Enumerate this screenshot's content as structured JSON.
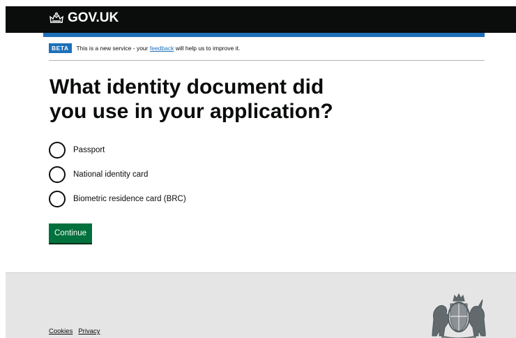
{
  "header": {
    "logo_text": "GOV.UK",
    "crown_icon": "crown-icon",
    "background": "#0b0c0c",
    "accent": "#1d70b8"
  },
  "phase_banner": {
    "tag": "BETA",
    "text_before": "This is a new service - your ",
    "link_text": "feedback",
    "text_after": " will help us to improve it."
  },
  "main": {
    "heading": "What identity document did you use in your application?",
    "options": [
      {
        "label": "Passport"
      },
      {
        "label": "National identity card"
      },
      {
        "label": "Biometric residence card (BRC)"
      }
    ],
    "continue_label": "Continue",
    "button_color": "#00703c"
  },
  "footer": {
    "links": [
      "Cookies",
      "Privacy"
    ],
    "crest_icon": "royal-coat-of-arms-icon",
    "background": "#e5e5e5"
  }
}
